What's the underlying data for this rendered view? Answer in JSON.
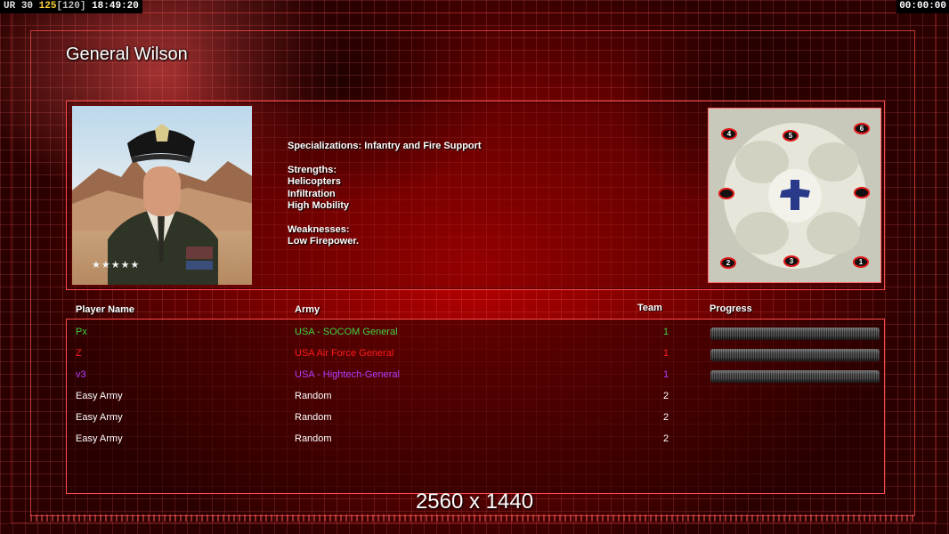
{
  "hud": {
    "ur_label": "UR",
    "ur_value": "30",
    "fps": "125",
    "fps_cap": "[120]",
    "clock": "18:49:20",
    "timer": "00:00:00"
  },
  "general": {
    "title": "General Wilson",
    "specializations": "Specializations: Infantry and Fire Support",
    "strengths_label": "Strengths:",
    "strengths": [
      "Helicopters",
      "Infiltration",
      "High Mobility"
    ],
    "weaknesses_label": "Weaknesses:",
    "weaknesses": [
      "Low Firepower."
    ],
    "rank_stars": "★★★★★"
  },
  "minimap": {
    "spawns": [
      {
        "label": "4"
      },
      {
        "label": "5"
      },
      {
        "label": "6"
      },
      {
        "label": ""
      },
      {
        "label": ""
      },
      {
        "label": "2"
      },
      {
        "label": "3"
      },
      {
        "label": "1"
      }
    ]
  },
  "roster": {
    "headers": {
      "player": "Player Name",
      "army": "Army",
      "team": "Team",
      "progress": "Progress"
    },
    "rows": [
      {
        "name": "Px",
        "army": "USA - SOCOM General",
        "team": "1",
        "color": "#3fd23f",
        "has_progress": true,
        "progress": 0
      },
      {
        "name": "Z",
        "army": "USA Air Force General",
        "team": "1",
        "color": "#ff1a1a",
        "has_progress": true,
        "progress": 0
      },
      {
        "name": "v3",
        "army": "USA - Hightech-General",
        "team": "1",
        "color": "#b23cff",
        "has_progress": true,
        "progress": 0
      },
      {
        "name": "Easy Army",
        "army": "Random",
        "team": "2",
        "color": "#ffffff",
        "has_progress": false
      },
      {
        "name": "Easy Army",
        "army": "Random",
        "team": "2",
        "color": "#ffffff",
        "has_progress": false
      },
      {
        "name": "Easy Army",
        "army": "Random",
        "team": "2",
        "color": "#ffffff",
        "has_progress": false
      }
    ]
  },
  "resolution_caption": "2560 x 1440",
  "colors": {
    "accent": "#ff4a4a",
    "background": "#b80000"
  }
}
